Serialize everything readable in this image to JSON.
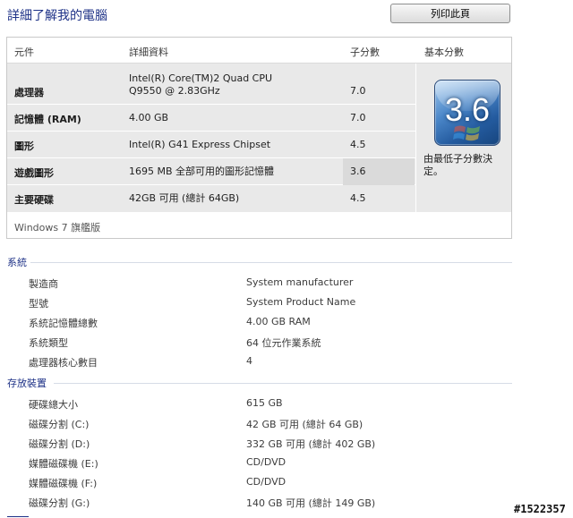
{
  "page": {
    "title": "詳細了解我的電腦",
    "print_label": "列印此頁"
  },
  "rating_table": {
    "headers": {
      "component": "元件",
      "details": "詳細資料",
      "subscore": "子分數",
      "base_score": "基本分數"
    },
    "rows": [
      {
        "component": "處理器",
        "details": "Intel(R) Core(TM)2 Quad CPU Q9550 @ 2.83GHz",
        "subscore": "7.0"
      },
      {
        "component": "記憶體 (RAM)",
        "details": "4.00 GB",
        "subscore": "7.0"
      },
      {
        "component": "圖形",
        "details": "Intel(R) G41 Express Chipset",
        "subscore": "4.5"
      },
      {
        "component": "遊戲圖形",
        "details": "1695 MB 全部可用的圖形記憶體",
        "subscore": "3.6",
        "lowest": true
      },
      {
        "component": "主要硬碟",
        "details": "42GB 可用 (總計 64GB)",
        "subscore": "4.5"
      }
    ],
    "base_score": "3.6",
    "base_caption": "由最低子分數決定。",
    "os_edition": "Windows 7 旗艦版"
  },
  "system_section": {
    "title": "系統",
    "items": [
      {
        "label": "製造商",
        "value": "System manufacturer"
      },
      {
        "label": "型號",
        "value": "System Product Name"
      },
      {
        "label": "系統記憶體總數",
        "value": "4.00 GB RAM"
      },
      {
        "label": "系統類型",
        "value": "64 位元作業系統"
      },
      {
        "label": "處理器核心數目",
        "value": "4"
      }
    ]
  },
  "storage_section": {
    "title": "存放裝置",
    "items": [
      {
        "label": "硬碟總大小",
        "value": "615 GB"
      },
      {
        "label": "磁碟分割 (C:)",
        "value": "42 GB 可用 (總計 64 GB)"
      },
      {
        "label": "磁碟分割 (D:)",
        "value": "332 GB 可用 (總計 402 GB)"
      },
      {
        "label": "媒體磁碟機 (E:)",
        "value": "CD/DVD"
      },
      {
        "label": "媒體磁碟機 (F:)",
        "value": "CD/DVD"
      },
      {
        "label": "磁碟分割 (G:)",
        "value": "140 GB 可用 (總計 149 GB)"
      }
    ]
  },
  "watermark": "#1522357",
  "colors": {
    "heading": "#1e3287",
    "table_bg": "#e9e9e9",
    "highlight": "#dadada",
    "badge_blue": "#245b9f"
  },
  "icons": {
    "score_badge": "windows-logo-icon"
  }
}
